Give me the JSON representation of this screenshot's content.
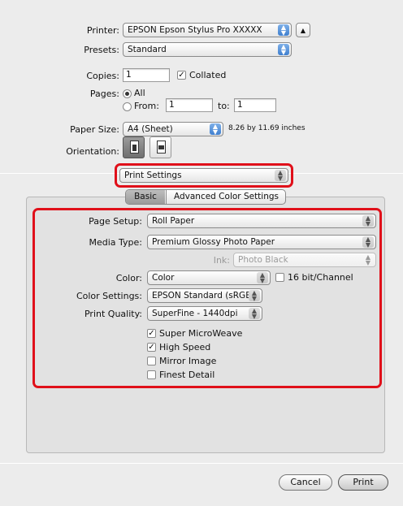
{
  "printer": {
    "label": "Printer:",
    "value": "EPSON Epson Stylus Pro XXXXX"
  },
  "presets": {
    "label": "Presets:",
    "value": "Standard"
  },
  "copies": {
    "label": "Copies:",
    "value": "1",
    "collated_label": "Collated",
    "collated_checked": true
  },
  "pages": {
    "label": "Pages:",
    "all_label": "All",
    "from_label": "From:",
    "from_value": "1",
    "to_label": "to:",
    "to_value": "1"
  },
  "paper_size": {
    "label": "Paper Size:",
    "value": "A4 (Sheet)",
    "dims": "8.26 by 11.69 inches"
  },
  "orientation": {
    "label": "Orientation:"
  },
  "section_popup": {
    "value": "Print Settings"
  },
  "tabs": {
    "basic": "Basic",
    "advanced": "Advanced Color Settings"
  },
  "settings": {
    "page_setup_label": "Page Setup:",
    "page_setup_value": "Roll Paper",
    "media_type_label": "Media Type:",
    "media_type_value": "Premium Glossy Photo Paper",
    "ink_label": "Ink:",
    "ink_value": "Photo Black",
    "color_label": "Color:",
    "color_value": "Color",
    "bit_label": "16 bit/Channel",
    "color_settings_label": "Color Settings:",
    "color_settings_value": "EPSON Standard (sRGB)",
    "print_quality_label": "Print Quality:",
    "print_quality_value": "SuperFine - 1440dpi",
    "options": [
      {
        "label": "Super MicroWeave",
        "checked": true
      },
      {
        "label": "High Speed",
        "checked": true
      },
      {
        "label": "Mirror Image",
        "checked": false
      },
      {
        "label": "Finest Detail",
        "checked": false
      }
    ]
  },
  "buttons": {
    "cancel": "Cancel",
    "print": "Print"
  },
  "colors": {
    "highlight": "#e0101a",
    "accent": "#3f7fcf"
  },
  "icons": [
    "disclosure-triangle-icon",
    "portrait-orientation-icon",
    "landscape-orientation-icon",
    "popup-arrows-icon"
  ]
}
